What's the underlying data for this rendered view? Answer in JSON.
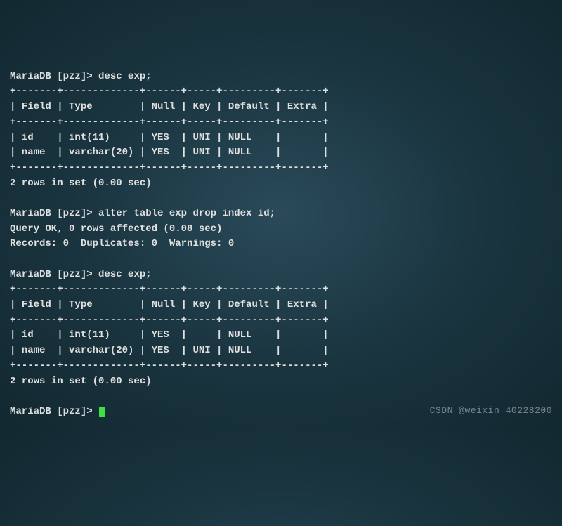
{
  "prompt_prefix": "MariaDB [pzz]> ",
  "blocks": {
    "cmd1": "desc exp;",
    "cmd2": "alter table exp drop index id;",
    "cmd3": "desc exp;",
    "alter_response": "Query OK, 0 rows affected (0.08 sec)\nRecords: 0  Duplicates: 0  Warnings: 0",
    "rows_msg": "2 rows in set (0.00 sec)"
  },
  "table1": {
    "sep": "+-------+-------------+------+-----+---------+-------+",
    "header": "| Field | Type        | Null | Key | Default | Extra |",
    "rows": [
      "| id    | int(11)     | YES  | UNI | NULL    |       |",
      "| name  | varchar(20) | YES  | UNI | NULL    |       |"
    ]
  },
  "table2": {
    "sep": "+-------+-------------+------+-----+---------+-------+",
    "header": "| Field | Type        | Null | Key | Default | Extra |",
    "rows": [
      "| id    | int(11)     | YES  |     | NULL    |       |",
      "| name  | varchar(20) | YES  | UNI | NULL    |       |"
    ]
  },
  "watermark": "CSDN @weixin_40228200"
}
